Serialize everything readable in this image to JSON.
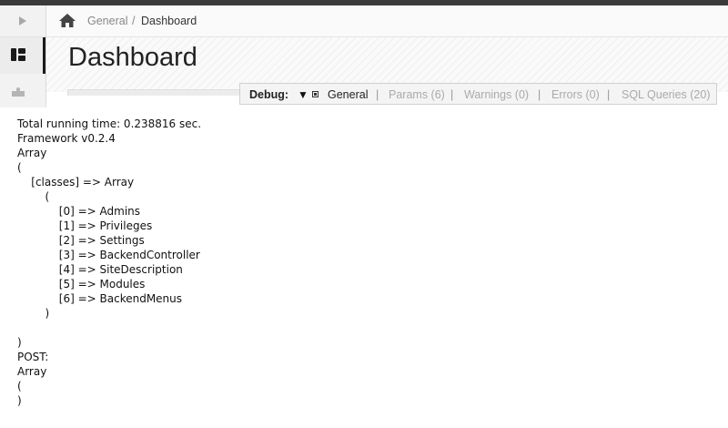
{
  "breadcrumb": {
    "root": "General",
    "separator": "/",
    "current": "Dashboard"
  },
  "page": {
    "title": "Dashboard"
  },
  "debug": {
    "label": "Debug:",
    "arrow": "▼",
    "separator": "|",
    "tabs": {
      "general": "General",
      "params": "Params (6)",
      "warnings": "Warnings (0)",
      "errors": "Errors (0)",
      "sql": "SQL Queries (20)"
    }
  },
  "output": {
    "lines": [
      "Total running time: 0.238816 sec.",
      "Framework v0.2.4",
      "Array",
      "(",
      "    [classes] => Array",
      "        (",
      "            [0] => Admins",
      "            [1] => Privileges",
      "            [2] => Settings",
      "            [3] => BackendController",
      "            [4] => SiteDescription",
      "            [5] => Modules",
      "            [6] => BackendMenus",
      "        )",
      "",
      ")",
      "POST:",
      "Array",
      "(",
      ")"
    ]
  },
  "icons": {
    "sidebar_toggle": "play-icon",
    "dashboard": "dashboard-icon",
    "plugins": "puzzle-icon",
    "home": "home-icon"
  }
}
